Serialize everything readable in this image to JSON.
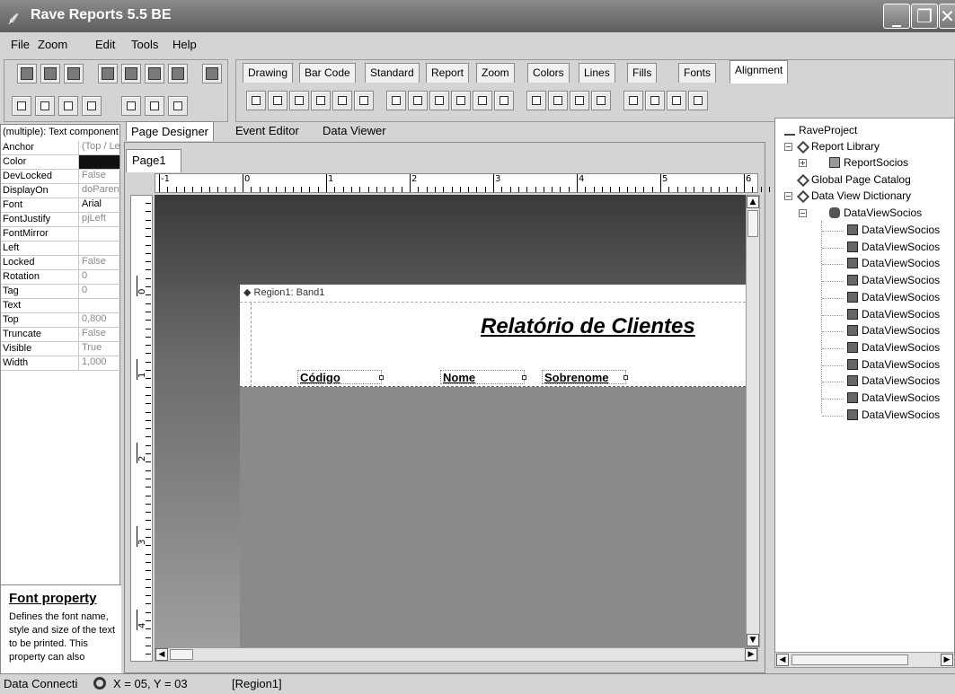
{
  "window": {
    "title": "Rave Reports 5.5 BE",
    "controls": [
      "minimize-icon",
      "restore-icon",
      "close-icon"
    ]
  },
  "menu": [
    "File",
    "Zoom",
    "Edit",
    "Tools",
    "Help"
  ],
  "component_tabs": [
    "Drawing",
    "Bar Code",
    "Standard",
    "Report",
    "Zoom",
    "Colors",
    "Lines",
    "Fills",
    "Fonts",
    "Alignment"
  ],
  "active_component_tab": "Alignment",
  "properties": {
    "header": "(multiple): Text component",
    "rows": [
      {
        "name": "Anchor",
        "value": "(Top / Left)"
      },
      {
        "name": "Color",
        "value": ""
      },
      {
        "name": "DevLocked",
        "value": "False"
      },
      {
        "name": "DisplayOn",
        "value": "doParent"
      },
      {
        "name": "Font",
        "value": "Arial"
      },
      {
        "name": "FontJustify",
        "value": "pjLeft"
      },
      {
        "name": "FontMirror",
        "value": ""
      },
      {
        "name": "Left",
        "value": ""
      },
      {
        "name": "Locked",
        "value": "False"
      },
      {
        "name": "Rotation",
        "value": "0"
      },
      {
        "name": "Tag",
        "value": "0"
      },
      {
        "name": "Text",
        "value": ""
      },
      {
        "name": "Top",
        "value": "0,800"
      },
      {
        "name": "Truncate",
        "value": "False"
      },
      {
        "name": "Visible",
        "value": "True"
      },
      {
        "name": "Width",
        "value": "1,000"
      }
    ],
    "color_swatch": "#111111",
    "help_title": "Font property",
    "help_text": "Defines the font name, style and size of the text to be printed. This property can also"
  },
  "editor_tabs": [
    "Page Designer",
    "Event Editor",
    "Data Viewer"
  ],
  "active_editor_tab": "Page Designer",
  "page_tab": "Page1",
  "ruler_h": [
    "-1",
    "0",
    "1",
    "2",
    "3",
    "4",
    "5",
    "6"
  ],
  "ruler_v": [
    "0",
    "1",
    "2",
    "3",
    "4"
  ],
  "band_label": "Region1: Band1",
  "report_title": "Relatório de Clientes",
  "fields": [
    "Código",
    "Nome",
    "Sobrenome"
  ],
  "tree": {
    "root": "RaveProject",
    "report_library": "Report Library",
    "report": "ReportSocios",
    "global_page_catalog": "Global Page Catalog",
    "data_view_dictionary": "Data View Dictionary",
    "data_view": "DataViewSocios",
    "fields": [
      "DataViewSocios",
      "DataViewSocios",
      "DataViewSocios",
      "DataViewSocios",
      "DataViewSocios",
      "DataViewSocios",
      "DataViewSocios",
      "DataViewSocios",
      "DataViewSocios",
      "DataViewSocios",
      "DataViewSocios",
      "DataViewSocios"
    ]
  },
  "status": {
    "connection": "Data Connecti",
    "coords": "X = 05, Y = 03",
    "selection": "[Region1]"
  }
}
